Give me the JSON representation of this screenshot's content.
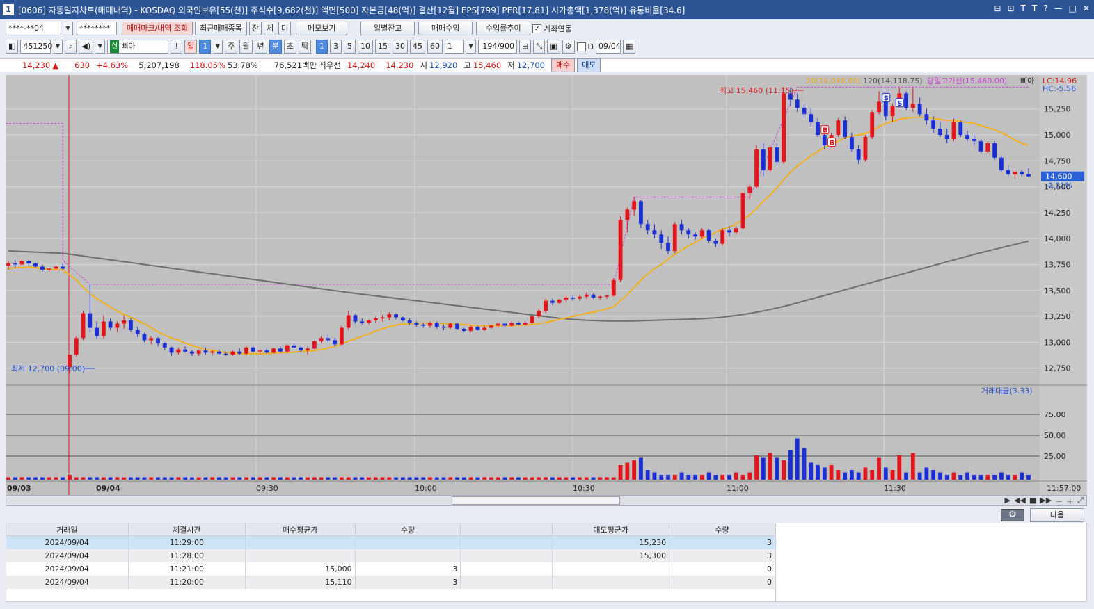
{
  "window": {
    "number": "1",
    "title": "[0606] 자동일지차트(매매내역) - KOSDAQ 외국인보유[55(천)] 주식수[9,682(천)] 액면[500] 자본금[48(억)] 결산[12월] EPS[799] PER[17.81] 시가총액[1,378(억)] 유통비율[34.6]",
    "controls": [
      "⊟",
      "⊡",
      "T",
      "T",
      "?",
      "—",
      "□",
      "✕"
    ]
  },
  "toolbar1": {
    "account": "****-**04",
    "password": "********",
    "btn_marks": "매매마크/내역 조회",
    "btn_recent": "최근매매종목",
    "btn_jan": "잔",
    "btn_che": "체",
    "btn_mi": "미",
    "btn_memo": "메모보기",
    "btn_daily": "일별잔고",
    "btn_profit": "매매수익",
    "btn_yield": "수익률추이",
    "account_link_label": "계좌연동"
  },
  "toolbar2": {
    "code": "451250",
    "badge": "신",
    "name": "삐아",
    "excl": "!",
    "day": "일",
    "day_n": "1",
    "periods": [
      "주",
      "월",
      "년",
      "분",
      "초",
      "틱"
    ],
    "intervals": [
      "1",
      "3",
      "5",
      "10",
      "15",
      "30",
      "45",
      "60"
    ],
    "count": "1",
    "bars": "194",
    "bars_total": "/900",
    "d_label": "D",
    "date": "09/04"
  },
  "quote": {
    "price": "14,230",
    "arrow": "▲",
    "change": "630",
    "pct": "+4.63%",
    "volume": "5,207,198",
    "vol_ratio": "118.05%",
    "turnover": "53.78%",
    "amount": "76,521백만",
    "best_label": "최우선",
    "best_ask": "14,240",
    "best_bid": "14,230",
    "open_label": "시",
    "open": "12,920",
    "high_label": "고",
    "high": "15,460",
    "low_label": "저",
    "low": "12,700",
    "buy": "매수",
    "sell": "매도"
  },
  "chart_data": {
    "type": "candlestick",
    "legend": {
      "ma20": "20(14,048.00)",
      "ma120": "120(14,118.75)",
      "dayhigh": "당일고가선(15,460.00)",
      "name": "삐아",
      "lc": "LC:14.96",
      "hc": "HC:-5.56"
    },
    "annotations": {
      "high": "최고 15,460 (11:15)",
      "low": "최저 12,700 (09:00)",
      "current": "14,600",
      "current_pct": "-0.21%"
    },
    "price_ticks": [
      "15,250",
      "15,000",
      "14,750",
      "14,500",
      "14,250",
      "14,000",
      "13,750",
      "13,500",
      "13,250",
      "13,000",
      "12,750"
    ],
    "volume_label": "거래대금(3.33)",
    "volume_ticks": [
      "75.00",
      "50.00",
      "25.00"
    ],
    "x_labels": [
      "09/03",
      "09/04",
      "09:30",
      "10:00",
      "10:30",
      "11:00",
      "11:30",
      "11:57:00"
    ],
    "ylim": [
      12600,
      15550
    ],
    "candles": [
      [
        13740,
        13780,
        13700,
        13760
      ],
      [
        13760,
        13790,
        13720,
        13750
      ],
      [
        13750,
        13800,
        13740,
        13780
      ],
      [
        13780,
        13790,
        13740,
        13760
      ],
      [
        13760,
        13770,
        13720,
        13730
      ],
      [
        13730,
        13750,
        13680,
        13700
      ],
      [
        13700,
        13720,
        13680,
        13710
      ],
      [
        13710,
        13740,
        13690,
        13730
      ],
      [
        13730,
        13760,
        13700,
        13710
      ],
      [
        12760,
        12800,
        12700,
        12880
      ],
      [
        12880,
        13060,
        12860,
        13040
      ],
      [
        13040,
        13300,
        13020,
        13280
      ],
      [
        13280,
        13560,
        13100,
        13140
      ],
      [
        13140,
        13200,
        13040,
        13060
      ],
      [
        13060,
        13260,
        13040,
        13200
      ],
      [
        13200,
        13230,
        13120,
        13140
      ],
      [
        13140,
        13200,
        13100,
        13180
      ],
      [
        13180,
        13260,
        13130,
        13210
      ],
      [
        13210,
        13230,
        13100,
        13120
      ],
      [
        13120,
        13150,
        13050,
        13080
      ],
      [
        13080,
        13090,
        13000,
        13020
      ],
      [
        13020,
        13060,
        12980,
        13040
      ],
      [
        13040,
        13050,
        12960,
        12990
      ],
      [
        12990,
        13000,
        12920,
        12950
      ],
      [
        12950,
        12960,
        12870,
        12900
      ],
      [
        12900,
        12950,
        12880,
        12930
      ],
      [
        12930,
        12960,
        12900,
        12910
      ],
      [
        12910,
        12920,
        12870,
        12890
      ],
      [
        12890,
        12930,
        12870,
        12920
      ],
      [
        12920,
        12950,
        12880,
        12900
      ],
      [
        12900,
        12920,
        12880,
        12910
      ],
      [
        12910,
        12930,
        12880,
        12890
      ],
      [
        12890,
        12900,
        12870,
        12880
      ],
      [
        12880,
        12920,
        12870,
        12910
      ],
      [
        12910,
        12940,
        12880,
        12890
      ],
      [
        12890,
        12960,
        12880,
        12950
      ],
      [
        12950,
        12960,
        12900,
        12910
      ],
      [
        12910,
        12930,
        12880,
        12920
      ],
      [
        12920,
        12940,
        12890,
        12900
      ],
      [
        12900,
        12950,
        12890,
        12940
      ],
      [
        12940,
        12960,
        12900,
        12910
      ],
      [
        12910,
        12980,
        12900,
        12970
      ],
      [
        12970,
        12990,
        12930,
        12950
      ],
      [
        12950,
        12970,
        12900,
        12920
      ],
      [
        12920,
        12960,
        12880,
        12940
      ],
      [
        12940,
        13020,
        12930,
        13010
      ],
      [
        13010,
        13060,
        12990,
        13040
      ],
      [
        13040,
        13080,
        13000,
        13020
      ],
      [
        13020,
        13040,
        12960,
        12980
      ],
      [
        12980,
        13160,
        12970,
        13140
      ],
      [
        13140,
        13300,
        13120,
        13260
      ],
      [
        13260,
        13270,
        13180,
        13200
      ],
      [
        13200,
        13230,
        13170,
        13190
      ],
      [
        13190,
        13220,
        13170,
        13210
      ],
      [
        13210,
        13250,
        13190,
        13230
      ],
      [
        13230,
        13260,
        13200,
        13240
      ],
      [
        13240,
        13290,
        13210,
        13270
      ],
      [
        13270,
        13280,
        13220,
        13240
      ],
      [
        13240,
        13250,
        13200,
        13210
      ],
      [
        13210,
        13230,
        13170,
        13190
      ],
      [
        13190,
        13200,
        13150,
        13170
      ],
      [
        13170,
        13190,
        13140,
        13160
      ],
      [
        13160,
        13200,
        13140,
        13190
      ],
      [
        13190,
        13200,
        13130,
        13150
      ],
      [
        13150,
        13170,
        13120,
        13140
      ],
      [
        13140,
        13190,
        13130,
        13180
      ],
      [
        13180,
        13190,
        13120,
        13130
      ],
      [
        13130,
        13140,
        13100,
        13110
      ],
      [
        13110,
        13160,
        13100,
        13150
      ],
      [
        13150,
        13160,
        13110,
        13120
      ],
      [
        13120,
        13160,
        13110,
        13140
      ],
      [
        13140,
        13170,
        13130,
        13160
      ],
      [
        13160,
        13190,
        13140,
        13180
      ],
      [
        13180,
        13190,
        13140,
        13160
      ],
      [
        13160,
        13200,
        13150,
        13190
      ],
      [
        13190,
        13200,
        13160,
        13170
      ],
      [
        13170,
        13200,
        13160,
        13190
      ],
      [
        13190,
        13260,
        13180,
        13250
      ],
      [
        13250,
        13320,
        13230,
        13300
      ],
      [
        13300,
        13420,
        13280,
        13400
      ],
      [
        13400,
        13420,
        13360,
        13380
      ],
      [
        13380,
        13420,
        13370,
        13410
      ],
      [
        13410,
        13450,
        13390,
        13430
      ],
      [
        13430,
        13450,
        13400,
        13420
      ],
      [
        13420,
        13460,
        13400,
        13440
      ],
      [
        13440,
        13480,
        13420,
        13460
      ],
      [
        13460,
        13470,
        13420,
        13430
      ],
      [
        13430,
        13450,
        13410,
        13440
      ],
      [
        13440,
        13460,
        13420,
        13450
      ],
      [
        13450,
        13620,
        13440,
        13600
      ],
      [
        13600,
        14220,
        13580,
        14180
      ],
      [
        14180,
        14300,
        14060,
        14280
      ],
      [
        14280,
        14400,
        14220,
        14360
      ],
      [
        14360,
        14370,
        14100,
        14140
      ],
      [
        14140,
        14180,
        14040,
        14080
      ],
      [
        14080,
        14140,
        14000,
        14040
      ],
      [
        14040,
        14080,
        13900,
        13960
      ],
      [
        13960,
        14020,
        13850,
        13880
      ],
      [
        13880,
        14160,
        13860,
        14140
      ],
      [
        14140,
        14180,
        14040,
        14080
      ],
      [
        14080,
        14100,
        14000,
        14040
      ],
      [
        14040,
        14060,
        13990,
        14020
      ],
      [
        14020,
        14100,
        14000,
        14080
      ],
      [
        14080,
        14090,
        13960,
        13980
      ],
      [
        13980,
        14000,
        13920,
        13950
      ],
      [
        13950,
        14100,
        13930,
        14080
      ],
      [
        14080,
        14120,
        14020,
        14060
      ],
      [
        14060,
        14120,
        14040,
        14100
      ],
      [
        14100,
        14460,
        14090,
        14440
      ],
      [
        14440,
        14520,
        14380,
        14500
      ],
      [
        14500,
        14900,
        14480,
        14860
      ],
      [
        14860,
        14920,
        14600,
        14660
      ],
      [
        14660,
        14900,
        14640,
        14880
      ],
      [
        14880,
        14920,
        14700,
        14740
      ],
      [
        14740,
        15460,
        14720,
        15400
      ],
      [
        15400,
        15460,
        15280,
        15340
      ],
      [
        15340,
        15400,
        15220,
        15260
      ],
      [
        15260,
        15300,
        15160,
        15200
      ],
      [
        15200,
        15260,
        15080,
        15120
      ],
      [
        15120,
        15160,
        14980,
        15000
      ],
      [
        15000,
        15040,
        14860,
        14900
      ],
      [
        14900,
        15020,
        14880,
        15000
      ],
      [
        15000,
        15160,
        14980,
        15140
      ],
      [
        15140,
        15180,
        14960,
        14980
      ],
      [
        14980,
        15020,
        14840,
        14860
      ],
      [
        14860,
        14900,
        14720,
        14760
      ],
      [
        14760,
        15000,
        14740,
        14980
      ],
      [
        14980,
        15240,
        14960,
        15220
      ],
      [
        15220,
        15420,
        15200,
        15320
      ],
      [
        15320,
        15400,
        15140,
        15180
      ],
      [
        15180,
        15300,
        15120,
        15280
      ],
      [
        15280,
        15460,
        15260,
        15400
      ],
      [
        15400,
        15420,
        15240,
        15260
      ],
      [
        15260,
        15460,
        15220,
        15300
      ],
      [
        15300,
        15360,
        15180,
        15200
      ],
      [
        15200,
        15260,
        15100,
        15140
      ],
      [
        15140,
        15180,
        15020,
        15060
      ],
      [
        15060,
        15120,
        14980,
        15000
      ],
      [
        15000,
        15060,
        14920,
        14960
      ],
      [
        14960,
        15160,
        14940,
        15120
      ],
      [
        15120,
        15140,
        14980,
        15000
      ],
      [
        15000,
        15040,
        14940,
        14960
      ],
      [
        14960,
        15000,
        14900,
        14940
      ],
      [
        14940,
        14960,
        14820,
        14840
      ],
      [
        14840,
        14940,
        14820,
        14920
      ],
      [
        14920,
        14940,
        14760,
        14780
      ],
      [
        14780,
        14800,
        14640,
        14660
      ],
      [
        14660,
        14700,
        14600,
        14620
      ],
      [
        14620,
        14660,
        14580,
        14640
      ],
      [
        14640,
        14660,
        14600,
        14620
      ],
      [
        14620,
        14680,
        14590,
        14600
      ]
    ],
    "volumes": [
      1,
      1,
      1,
      1,
      1,
      1,
      1,
      1,
      1,
      2,
      1,
      1,
      1,
      1,
      1,
      1,
      1,
      1,
      1,
      1,
      1,
      1,
      1,
      1,
      1,
      1,
      1,
      1,
      1,
      1,
      1,
      1,
      1,
      1,
      1,
      1,
      1,
      1,
      1,
      1,
      1,
      1,
      1,
      1,
      1,
      1,
      1,
      1,
      1,
      1,
      1,
      1,
      1,
      1,
      1,
      1,
      1,
      1,
      1,
      1,
      1,
      1,
      1,
      1,
      1,
      1,
      1,
      1,
      1,
      1,
      1,
      1,
      1,
      1,
      1,
      1,
      1,
      1,
      1,
      1,
      1,
      1,
      1,
      1,
      1,
      1,
      1,
      1,
      1,
      1,
      6,
      7,
      8,
      9,
      4,
      3,
      2,
      2,
      2,
      3,
      2,
      2,
      2,
      3,
      2,
      2,
      2,
      3,
      2,
      3,
      10,
      9,
      11,
      9,
      8,
      12,
      17,
      13,
      7,
      6,
      5,
      6,
      4,
      3,
      4,
      3,
      5,
      4,
      9,
      5,
      4,
      10,
      3,
      11,
      3,
      5,
      4,
      3,
      2,
      3,
      2,
      3,
      2,
      2,
      2,
      2,
      3,
      2,
      2,
      3,
      2
    ],
    "ma20": [
      13710,
      13720,
      13720,
      13725,
      13720,
      13710,
      13700,
      13700,
      13700,
      13650,
      13600,
      13530,
      13470,
      13420,
      13380,
      13340,
      13300,
      13270,
      13240,
      13210,
      13180,
      13140,
      13100,
      13070,
      13040,
      13020,
      12990,
      12970,
      12950,
      12930,
      12920,
      12910,
      12900,
      12895,
      12890,
      12890,
      12890,
      12890,
      12890,
      12895,
      12900,
      12900,
      12905,
      12910,
      12915,
      12920,
      12930,
      12945,
      12960,
      12985,
      13010,
      13030,
      13060,
      13080,
      13110,
      13130,
      13150,
      13165,
      13175,
      13180,
      13185,
      13185,
      13185,
      13185,
      13180,
      13180,
      13175,
      13170,
      13165,
      13160,
      13160,
      13160,
      13160,
      13160,
      13160,
      13165,
      13165,
      13170,
      13180,
      13190,
      13205,
      13220,
      13235,
      13250,
      13265,
      13280,
      13290,
      13305,
      13320,
      13345,
      13400,
      13460,
      13530,
      13600,
      13660,
      13710,
      13750,
      13800,
      13850,
      13890,
      13930,
      13965,
      14000,
      14030,
      14060,
      14090,
      14110,
      14140,
      14180,
      14230,
      14290,
      14360,
      14420,
      14490,
      14570,
      14640,
      14700,
      14750,
      14800,
      14840,
      14880,
      14910,
      14940,
      14970,
      14990,
      15000,
      15010,
      15040,
      15080,
      15110,
      15130,
      15150,
      15160,
      15170,
      15170,
      15170,
      15160,
      15150,
      15140,
      15140,
      15130,
      15120,
      15110,
      15090,
      15070,
      15050,
      15020,
      14990,
      14950,
      14920,
      14900
    ],
    "ma120": [
      13880,
      13878,
      13875,
      13872,
      13870,
      13867,
      13864,
      13861,
      13858,
      13850,
      13840,
      13831,
      13822,
      13813,
      13804,
      13795,
      13786,
      13777,
      13768,
      13759,
      13750,
      13741,
      13732,
      13723,
      13714,
      13705,
      13696,
      13687,
      13678,
      13669,
      13660,
      13651,
      13642,
      13633,
      13624,
      13615,
      13606,
      13597,
      13588,
      13579,
      13570,
      13561,
      13552,
      13543,
      13534,
      13525,
      13516,
      13507,
      13498,
      13489,
      13480,
      13472,
      13464,
      13456,
      13448,
      13440,
      13432,
      13424,
      13416,
      13408,
      13400,
      13392,
      13384,
      13376,
      13368,
      13360,
      13352,
      13344,
      13336,
      13328,
      13320,
      13312,
      13304,
      13296,
      13288,
      13280,
      13272,
      13264,
      13256,
      13248,
      13240,
      13232,
      13226,
      13220,
      13216,
      13212,
      13210,
      13208,
      13206,
      13205,
      13205,
      13205,
      13206,
      13208,
      13210,
      13212,
      13214,
      13216,
      13218,
      13220,
      13222,
      13225,
      13228,
      13232,
      13236,
      13242,
      13250,
      13258,
      13268,
      13278,
      13290,
      13302,
      13316,
      13330,
      13346,
      13362,
      13380,
      13398,
      13416,
      13434,
      13452,
      13470,
      13488,
      13506,
      13524,
      13542,
      13560,
      13578,
      13596,
      13614,
      13632,
      13650,
      13668,
      13686,
      13704,
      13722,
      13740,
      13758,
      13776,
      13794,
      13812,
      13830,
      13848,
      13864,
      13880,
      13896,
      13912,
      13928,
      13944,
      13960,
      13976
    ]
  },
  "bottom": {
    "next_label": "다음",
    "gear_icon": "gear-icon"
  },
  "trades": {
    "headers": [
      "거래일",
      "체결시간",
      "매수평균가",
      "수량",
      "",
      "매도평균가",
      "수량"
    ],
    "rows": [
      [
        "2024/09/04",
        "11:29:00",
        "",
        "",
        "",
        "15,230",
        "3"
      ],
      [
        "2024/09/04",
        "11:28:00",
        "",
        "",
        "",
        "15,300",
        "3"
      ],
      [
        "2024/09/04",
        "11:21:00",
        "15,000",
        "3",
        "",
        "",
        "0"
      ],
      [
        "2024/09/04",
        "11:20:00",
        "15,110",
        "3",
        "",
        "",
        "0"
      ]
    ]
  }
}
